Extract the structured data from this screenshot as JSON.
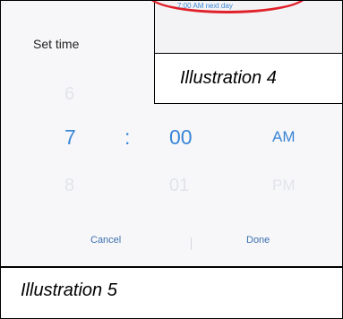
{
  "dialog": {
    "title": "Set time",
    "picker": {
      "previous": {
        "hour": "6",
        "minute": "",
        "ampm": ""
      },
      "current": {
        "hour": "7",
        "separator": ":",
        "minute": "00",
        "ampm": "AM"
      },
      "next": {
        "hour": "8",
        "minute": "01",
        "ampm": "PM"
      }
    },
    "buttons": {
      "cancel": "Cancel",
      "done": "Done"
    }
  },
  "illustration4": {
    "alarm_subtext": "7:00 AM next day",
    "caption": "Illustration 4",
    "highlight_color": "#e0212a"
  },
  "illustration5": {
    "caption": "Illustration 5"
  },
  "colors": {
    "accent": "#3a86d6",
    "faded_digit": "#e1e4ea"
  }
}
